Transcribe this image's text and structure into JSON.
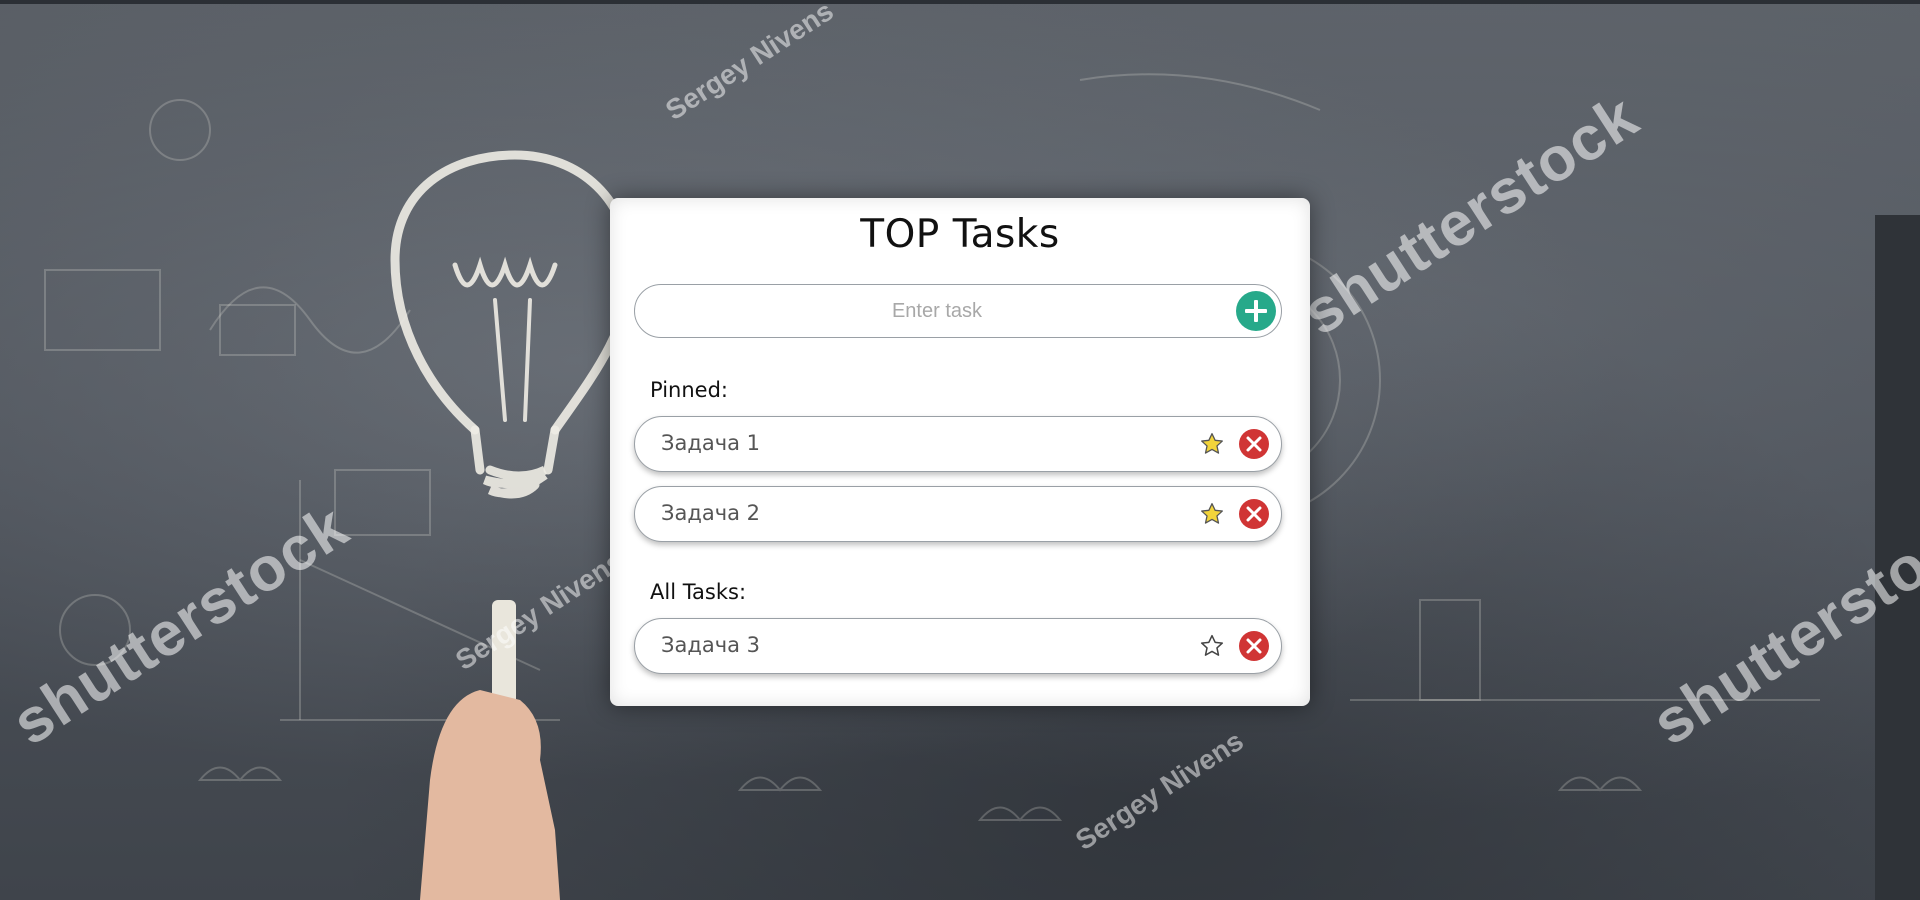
{
  "app": {
    "title": "TOP Tasks"
  },
  "new_task": {
    "placeholder": "Enter task",
    "value": "",
    "add_icon": "plus-circle-icon"
  },
  "sections": {
    "pinned_label": "Pinned:",
    "all_label": "All Tasks:"
  },
  "pinned_tasks": [
    {
      "text": "Задача 1",
      "pinned": true
    },
    {
      "text": "Задача 2",
      "pinned": true
    }
  ],
  "all_tasks": [
    {
      "text": "Задача 3",
      "pinned": false
    }
  ],
  "colors": {
    "add_button": "#27a98a",
    "delete_button": "#d03535",
    "star_pinned": "#f2d43a",
    "star_unpinned": "#ffffff"
  },
  "background": {
    "watermark_brand": "shutterstock",
    "watermark_author": "Sergey Nivens"
  }
}
